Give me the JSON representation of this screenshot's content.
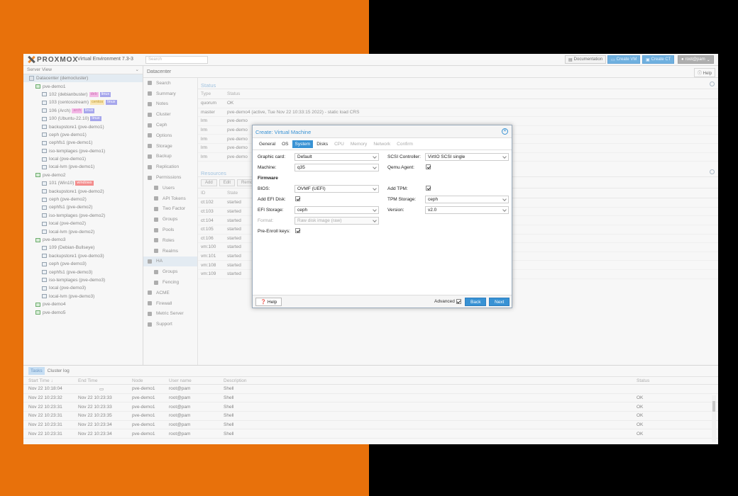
{
  "app": {
    "brand": "PROXMOX",
    "version": "Virtual Environment 7.3-3",
    "search_placeholder": "Search",
    "buttons": {
      "documentation": "Documentation",
      "create_vm": "Create VM",
      "create_ct": "Create CT",
      "user": "root@pam"
    }
  },
  "sidebar": {
    "view": "Server View",
    "items": [
      {
        "label": "Datacenter (democluster)",
        "level": 0,
        "type": "dc",
        "selected": true
      },
      {
        "label": "pve-demo1",
        "level": 1,
        "type": "node"
      },
      {
        "label": "102 (debianbuster)",
        "level": 2,
        "type": "ct",
        "tags": [
          [
            "deb",
            "deb"
          ],
          [
            "linux",
            "linux"
          ]
        ]
      },
      {
        "label": "103 (centosstream)",
        "level": 2,
        "type": "ct",
        "tags": [
          [
            "centos",
            "centos"
          ],
          [
            "linux",
            "linux"
          ]
        ]
      },
      {
        "label": "106 (Arch)",
        "level": 2,
        "type": "ct",
        "tags": [
          [
            "arch",
            "arch"
          ],
          [
            "linux",
            "linux"
          ]
        ]
      },
      {
        "label": "100 (Ubuntu-22.10)",
        "level": 2,
        "type": "vm",
        "tags": [
          [
            "linux",
            "linux"
          ]
        ]
      },
      {
        "label": "backupstore1 (pve-demo1)",
        "level": 2,
        "type": "storage"
      },
      {
        "label": "ceph (pve-demo1)",
        "level": 2,
        "type": "storage"
      },
      {
        "label": "cephfs1 (pve-demo1)",
        "level": 2,
        "type": "storage"
      },
      {
        "label": "iso-templages (pve-demo1)",
        "level": 2,
        "type": "storage"
      },
      {
        "label": "local (pve-demo1)",
        "level": 2,
        "type": "storage"
      },
      {
        "label": "local-lvm (pve-demo1)",
        "level": 2,
        "type": "storage"
      },
      {
        "label": "pve-demo2",
        "level": 1,
        "type": "node"
      },
      {
        "label": "101 (Win10)",
        "level": 2,
        "type": "vm",
        "tags": [
          [
            "windows",
            "win"
          ]
        ]
      },
      {
        "label": "backupstore1 (pve-demo2)",
        "level": 2,
        "type": "storage"
      },
      {
        "label": "ceph (pve-demo2)",
        "level": 2,
        "type": "storage"
      },
      {
        "label": "cephfs1 (pve-demo2)",
        "level": 2,
        "type": "storage"
      },
      {
        "label": "iso-templages (pve-demo2)",
        "level": 2,
        "type": "storage"
      },
      {
        "label": "local (pve-demo2)",
        "level": 2,
        "type": "storage"
      },
      {
        "label": "local-lvm (pve-demo2)",
        "level": 2,
        "type": "storage"
      },
      {
        "label": "pve-demo3",
        "level": 1,
        "type": "node"
      },
      {
        "label": "109 (Debian-Bullseye)",
        "level": 2,
        "type": "vm"
      },
      {
        "label": "backupstore1 (pve-demo3)",
        "level": 2,
        "type": "storage"
      },
      {
        "label": "ceph (pve-demo3)",
        "level": 2,
        "type": "storage"
      },
      {
        "label": "cephfs1 (pve-demo3)",
        "level": 2,
        "type": "storage"
      },
      {
        "label": "iso-templages (pve-demo3)",
        "level": 2,
        "type": "storage"
      },
      {
        "label": "local (pve-demo3)",
        "level": 2,
        "type": "storage"
      },
      {
        "label": "local-lvm (pve-demo3)",
        "level": 2,
        "type": "storage"
      },
      {
        "label": "pve-demo4",
        "level": 1,
        "type": "node"
      },
      {
        "label": "pve-demo5",
        "level": 1,
        "type": "node"
      }
    ]
  },
  "panel": {
    "title": "Datacenter",
    "help": "Help"
  },
  "menu": [
    {
      "label": "Search",
      "sub": false
    },
    {
      "label": "Summary",
      "sub": false
    },
    {
      "label": "Notes",
      "sub": false
    },
    {
      "label": "Cluster",
      "sub": false
    },
    {
      "label": "Ceph",
      "sub": false
    },
    {
      "label": "Options",
      "sub": false
    },
    {
      "label": "Storage",
      "sub": false
    },
    {
      "label": "Backup",
      "sub": false
    },
    {
      "label": "Replication",
      "sub": false
    },
    {
      "label": "Permissions",
      "sub": false
    },
    {
      "label": "Users",
      "sub": true
    },
    {
      "label": "API Tokens",
      "sub": true
    },
    {
      "label": "Two Factor",
      "sub": true
    },
    {
      "label": "Groups",
      "sub": true
    },
    {
      "label": "Pools",
      "sub": true
    },
    {
      "label": "Roles",
      "sub": true
    },
    {
      "label": "Realms",
      "sub": true
    },
    {
      "label": "HA",
      "sub": false,
      "selected": true
    },
    {
      "label": "Groups",
      "sub": true
    },
    {
      "label": "Fencing",
      "sub": true
    },
    {
      "label": "ACME",
      "sub": false
    },
    {
      "label": "Firewall",
      "sub": false
    },
    {
      "label": "Metric Server",
      "sub": false
    },
    {
      "label": "Support",
      "sub": false
    }
  ],
  "status": {
    "title": "Status",
    "headers": [
      "Type",
      "Status"
    ],
    "rows": [
      [
        "quorum",
        "OK"
      ],
      [
        "master",
        "pve-demo4 (active, Tue Nov 22 10:33:15 2022) - static load CRS"
      ],
      [
        "lrm",
        "pve-demo"
      ],
      [
        "lrm",
        "pve-demo"
      ],
      [
        "lrm",
        "pve-demo"
      ],
      [
        "lrm",
        "pve-demo"
      ],
      [
        "lrm",
        "pve-demo"
      ]
    ]
  },
  "resources": {
    "title": "Resources",
    "toolbar": [
      "Add",
      "Edit",
      "Remo"
    ],
    "headers": [
      "ID",
      "State"
    ],
    "rows": [
      [
        "ct:102",
        "started"
      ],
      [
        "ct:103",
        "started"
      ],
      [
        "ct:104",
        "started"
      ],
      [
        "ct:105",
        "started"
      ],
      [
        "ct:106",
        "started"
      ],
      [
        "vm:100",
        "started"
      ],
      [
        "vm:101",
        "started"
      ],
      [
        "vm:108",
        "started"
      ],
      [
        "vm:109",
        "started"
      ]
    ]
  },
  "tasks": {
    "tabs": [
      "Tasks",
      "Cluster log"
    ],
    "headers": [
      "Start Time",
      "End Time",
      "Node",
      "User name",
      "Description",
      "Status"
    ],
    "rows": [
      [
        "Nov 22 10:18:04",
        "",
        "pve-demo1",
        "root@pam",
        "Shell",
        ""
      ],
      [
        "Nov 22 10:23:32",
        "Nov 22 10:23:33",
        "pve-demo1",
        "root@pam",
        "Shell",
        "OK"
      ],
      [
        "Nov 22 10:23:31",
        "Nov 22 10:23:33",
        "pve-demo1",
        "root@pam",
        "Shell",
        "OK"
      ],
      [
        "Nov 22 10:23:31",
        "Nov 22 10:23:35",
        "pve-demo1",
        "root@pam",
        "Shell",
        "OK"
      ],
      [
        "Nov 22 10:23:31",
        "Nov 22 10:23:34",
        "pve-demo1",
        "root@pam",
        "Shell",
        "OK"
      ],
      [
        "Nov 22 10:23:31",
        "Nov 22 10:23:34",
        "pve-demo1",
        "root@pam",
        "Shell",
        "OK"
      ]
    ]
  },
  "modal": {
    "title": "Create: Virtual Machine",
    "tabs": [
      "General",
      "OS",
      "System",
      "Disks",
      "CPU",
      "Memory",
      "Network",
      "Confirm"
    ],
    "active_tab": "System",
    "graphic_card_label": "Graphic card:",
    "graphic_card": "Default",
    "machine_label": "Machine:",
    "machine": "q35",
    "firmware_label": "Firmware",
    "bios_label": "BIOS:",
    "bios": "OVMF (UEFI)",
    "add_efi_label": "Add EFI Disk:",
    "efi_storage_label": "EFI Storage:",
    "efi_storage": "ceph",
    "format_label": "Format:",
    "format": "Raw disk image (raw)",
    "pre_enroll_label": "Pre-Enroll keys:",
    "scsi_label": "SCSI Controller:",
    "scsi": "VirtIO SCSI single",
    "qemu_agent_label": "Qemu Agent:",
    "add_tpm_label": "Add TPM:",
    "tpm_storage_label": "TPM Storage:",
    "tpm_storage": "ceph",
    "version_label": "Version:",
    "version": "v2.0",
    "help": "Help",
    "advanced": "Advanced",
    "back": "Back",
    "next": "Next"
  }
}
